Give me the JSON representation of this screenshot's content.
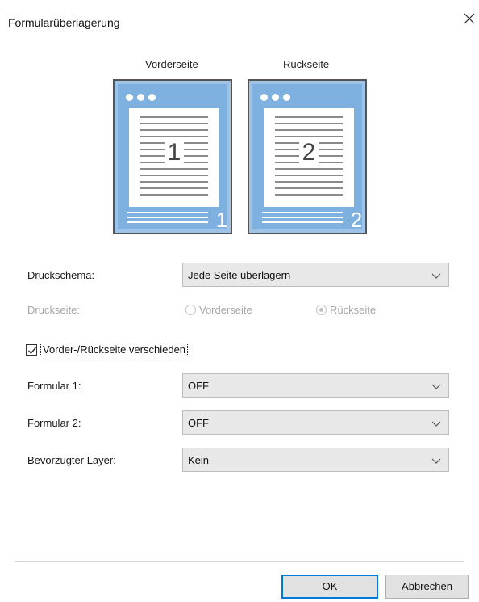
{
  "window": {
    "title": "Formularüberlagerung",
    "close_icon": "close-icon"
  },
  "preview": {
    "front_label": "Vorderseite",
    "back_label": "Rückseite",
    "front_page_number": "1",
    "back_page_number": "2",
    "front_corner_number": "1",
    "back_corner_number": "2",
    "accent_color": "#7fb1e0"
  },
  "print_scheme": {
    "label": "Druckschema:",
    "value": "Jede Seite überlagern"
  },
  "print_side": {
    "label": "Druckseite:",
    "options": [
      "Vorderseite",
      "Rückseite"
    ],
    "selected": "Rückseite",
    "enabled": false
  },
  "different_sides": {
    "label": "Vorder-/Rückseite verschieden",
    "checked": true
  },
  "form1": {
    "label": "Formular 1:",
    "value": "OFF"
  },
  "form2": {
    "label": "Formular 2:",
    "value": "OFF"
  },
  "preferred_layer": {
    "label": "Bevorzugter Layer:",
    "value": "Kein"
  },
  "buttons": {
    "ok": "OK",
    "cancel": "Abbrechen"
  }
}
